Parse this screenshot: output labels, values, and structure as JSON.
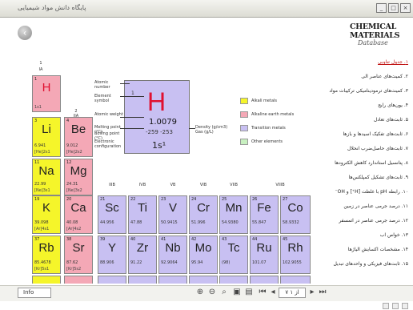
{
  "window": {
    "title": "پایگاه دانش مواد شیمیایی"
  },
  "header": {
    "logo_main": "CHEMICAL MATERIALS",
    "logo_sub": "Database"
  },
  "key_element": {
    "number": "1",
    "symbol": "H",
    "mass": "1.0079",
    "temps": "-259   -253",
    "config": "1s¹",
    "labels": {
      "atomic_number": "Atomic number",
      "element_symbol": "Element symbol",
      "atomic_weight": "Atomic weight",
      "melting": "Melting point (°C)",
      "boiling": "Boiling point (°C)",
      "electronic": "Electronic configuration",
      "density": "Density (g/cm3) Gas (g/L)"
    }
  },
  "legend": [
    {
      "label": "Alkali metals",
      "color": "#f5f52a"
    },
    {
      "label": "Alkaline earth metals",
      "color": "#f4a8b6"
    },
    {
      "label": "Transition metals",
      "color": "#c8c0f2"
    },
    {
      "label": "Other elements",
      "color": "#c8f0c0"
    }
  ],
  "group_headers": [
    "IIIB",
    "IVB",
    "VB",
    "VIB",
    "VIIB",
    "VIIIB"
  ],
  "elements": [
    {
      "n": "1",
      "s": "H",
      "m": "",
      "c": "1s1",
      "cls": "p"
    },
    {
      "n": "3",
      "s": "Li",
      "m": "6.941",
      "c": "[He]2s1",
      "cls": "y"
    },
    {
      "n": "4",
      "s": "Be",
      "m": "9.012",
      "c": "[He]2s2",
      "cls": "p"
    },
    {
      "n": "11",
      "s": "Na",
      "m": "22.99",
      "c": "[Ne]3s1",
      "cls": "y"
    },
    {
      "n": "12",
      "s": "Mg",
      "m": "24.31",
      "c": "[Ne]3s2",
      "cls": "p"
    },
    {
      "n": "19",
      "s": "K",
      "m": "39.098",
      "c": "[Ar]4s1",
      "cls": "y"
    },
    {
      "n": "20",
      "s": "Ca",
      "m": "40.08",
      "c": "[Ar]4s2",
      "cls": "p"
    },
    {
      "n": "21",
      "s": "Sc",
      "m": "44.956",
      "c": "",
      "cls": "v"
    },
    {
      "n": "22",
      "s": "Ti",
      "m": "47.88",
      "c": "",
      "cls": "v"
    },
    {
      "n": "23",
      "s": "V",
      "m": "50.9415",
      "c": "",
      "cls": "v"
    },
    {
      "n": "24",
      "s": "Cr",
      "m": "51.996",
      "c": "",
      "cls": "v"
    },
    {
      "n": "25",
      "s": "Mn",
      "m": "54.9380",
      "c": "",
      "cls": "v"
    },
    {
      "n": "26",
      "s": "Fe",
      "m": "55.847",
      "c": "",
      "cls": "v"
    },
    {
      "n": "27",
      "s": "Co",
      "m": "58.9332",
      "c": "",
      "cls": "v"
    },
    {
      "n": "37",
      "s": "Rb",
      "m": "85.4678",
      "c": "[Kr]5s1",
      "cls": "y"
    },
    {
      "n": "38",
      "s": "Sr",
      "m": "87.62",
      "c": "[Kr]5s2",
      "cls": "p"
    },
    {
      "n": "39",
      "s": "Y",
      "m": "88.906",
      "c": "",
      "cls": "v"
    },
    {
      "n": "40",
      "s": "Zr",
      "m": "91.22",
      "c": "",
      "cls": "v"
    },
    {
      "n": "41",
      "s": "Nb",
      "m": "92.9064",
      "c": "",
      "cls": "v"
    },
    {
      "n": "42",
      "s": "Mo",
      "m": "95.94",
      "c": "",
      "cls": "v"
    },
    {
      "n": "43",
      "s": "Tc",
      "m": "(98)",
      "c": "",
      "cls": "v"
    },
    {
      "n": "44",
      "s": "Ru",
      "m": "101.07",
      "c": "",
      "cls": "v"
    },
    {
      "n": "45",
      "s": "Rh",
      "m": "102.9055",
      "c": "",
      "cls": "v"
    }
  ],
  "menu": [
    {
      "label": "۱. جدول تناوبی",
      "active": true
    },
    {
      "label": "۲. کمیت‌های عناصر آلی",
      "active": false
    },
    {
      "label": "۳. کمیت‌های ترمودینامیکی ترکیبات مواد",
      "active": false
    },
    {
      "label": "۴. یون‌های رایج",
      "active": false
    },
    {
      "label": "۵. ثابت‌های تعادل",
      "active": false
    },
    {
      "label": "۶. ثابت‌های تفکیک اسیدها و بازها",
      "active": false
    },
    {
      "label": "۷. ثابت‌های حاصل‌ضرب انحلال",
      "active": false
    },
    {
      "label": "۸. پتانسیل استاندارد کاهش الکترودها",
      "active": false
    },
    {
      "label": "۹. ثابت‌های تشکیل کمپلکس‌ها",
      "active": false
    },
    {
      "label": "۱۰. رابطه pH با غلظت [H⁺] و OH⁻",
      "active": false
    },
    {
      "label": "۱۱. درصد جرمی عناصر در زمین",
      "active": false
    },
    {
      "label": "۱۲. درصد جرمی عناصر در اتمسفر",
      "active": false
    },
    {
      "label": "۱۳. خواص آب",
      "active": false
    },
    {
      "label": "۱۴. مشخصات اکسایش آلیاژها",
      "active": false
    },
    {
      "label": "۱۵. ثابت‌های فیزیکی و واحدهای تبدیل",
      "active": false
    }
  ],
  "statusbar": {
    "left": "Info",
    "page": "۷ از ۱"
  }
}
